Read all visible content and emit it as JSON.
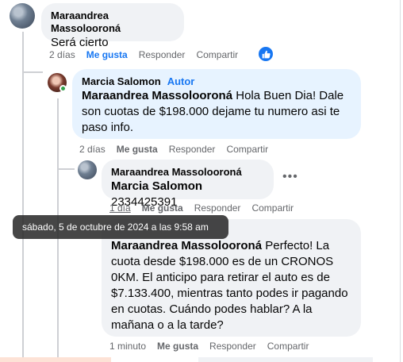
{
  "comments": [
    {
      "author": "Maraandrea Massolooroná",
      "text": "Será cierto",
      "time": "2 días",
      "like": "Me gusta",
      "reply": "Responder",
      "share": "Compartir"
    },
    {
      "author": "Marcia Salomon",
      "badge": "Autor",
      "mention": "Maraandrea Massolooroná",
      "text_lines": [
        "Hola Buen Dia! Dale",
        "son cuotas de $198.000 dejame tu numero asi te",
        "paso info."
      ],
      "time": "2 días",
      "like": "Me gusta",
      "reply": "Responder",
      "share": "Compartir"
    },
    {
      "author": "Maraandrea Massolooroná",
      "mention": "Marcia Salomon",
      "text": "2334425391",
      "time": "1 día",
      "like": "Me gusta",
      "reply": "Responder",
      "share": "Compartir"
    },
    {
      "author": "Marcia Salomon",
      "mention": "Maraandrea Massolooroná",
      "text_lines": [
        " Perfecto! La",
        "cuota desde $198.000 es de un CRONOS",
        "0KM. El anticipo para retirar el auto es de",
        "$7.133.400, mientras tanto podes ir pagando",
        "en cuotas. Cuándo podes hablar? A la",
        "mañana o a la tarde?"
      ],
      "time": "1 minuto",
      "like": "Me gusta",
      "reply": "Responder",
      "share": "Compartir"
    }
  ],
  "tooltip": "sábado, 5 de octubre de 2024 a las 9:58 am",
  "more_icon": "•••",
  "icons": {
    "like_reaction": "thumbs-up-icon",
    "more": "more-options-icon"
  },
  "colors": {
    "accent": "#1877f2",
    "bubble": "#f0f2f5",
    "author_bubble": "#e7f3ff"
  }
}
